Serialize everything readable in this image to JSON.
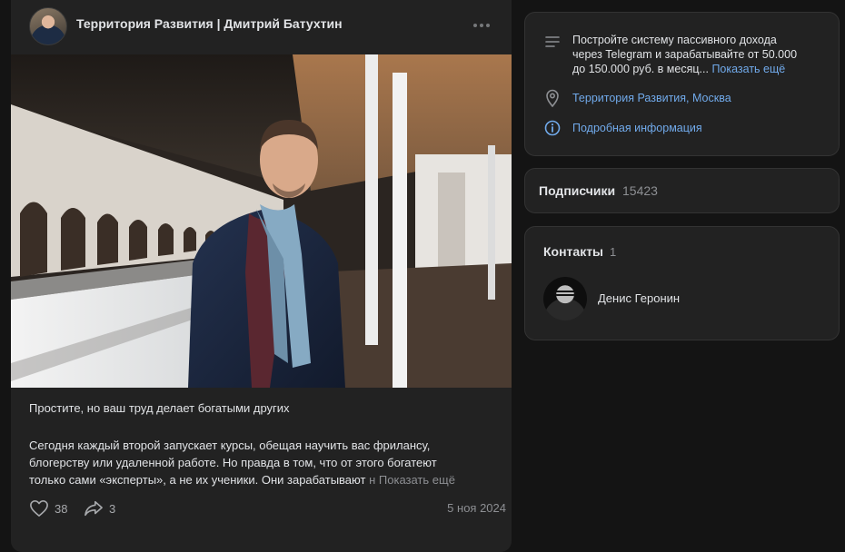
{
  "post": {
    "author": "Территория Развития | Дмитрий Батухтин",
    "title": "Простите, но ваш труд делает богатыми других",
    "body_lines": [
      "Сегодня каждый второй запускает курсы, обещая научить вас фрилансу,",
      "блогерству или удаленной работе. Но правда в том, что от этого богатеют",
      "только сами «эксперты», а не их ученики. Они зарабатывают"
    ],
    "body_fade": " н",
    "show_more": "Показать ещё",
    "likes": "38",
    "shares": "3",
    "date": "5 ноя 2024",
    "icons": {
      "more": "more-horizontal-icon",
      "like": "heart-icon",
      "share": "share-arrow-icon"
    }
  },
  "sidebar": {
    "about": {
      "lines": [
        "Постройте систему пассивного дохода",
        "через Telegram и зарабатывайте от 50.000",
        "до 150.000 руб. в месяц..."
      ],
      "show_more": "Показать ещё"
    },
    "location": "Территория Развития, Москва",
    "details_link": "Подробная информация",
    "subscribers": {
      "label": "Подписчики",
      "count": "15423"
    },
    "contacts": {
      "label": "Контакты",
      "count": "1",
      "items": [
        {
          "name": "Денис Геронин"
        }
      ]
    },
    "icons": {
      "about": "text-lines-icon",
      "location": "location-pin-icon",
      "info": "info-circle-icon"
    }
  },
  "colors": {
    "background": "#141414",
    "card": "#222222",
    "link": "#71aaeb",
    "muted": "#8d8f93"
  }
}
